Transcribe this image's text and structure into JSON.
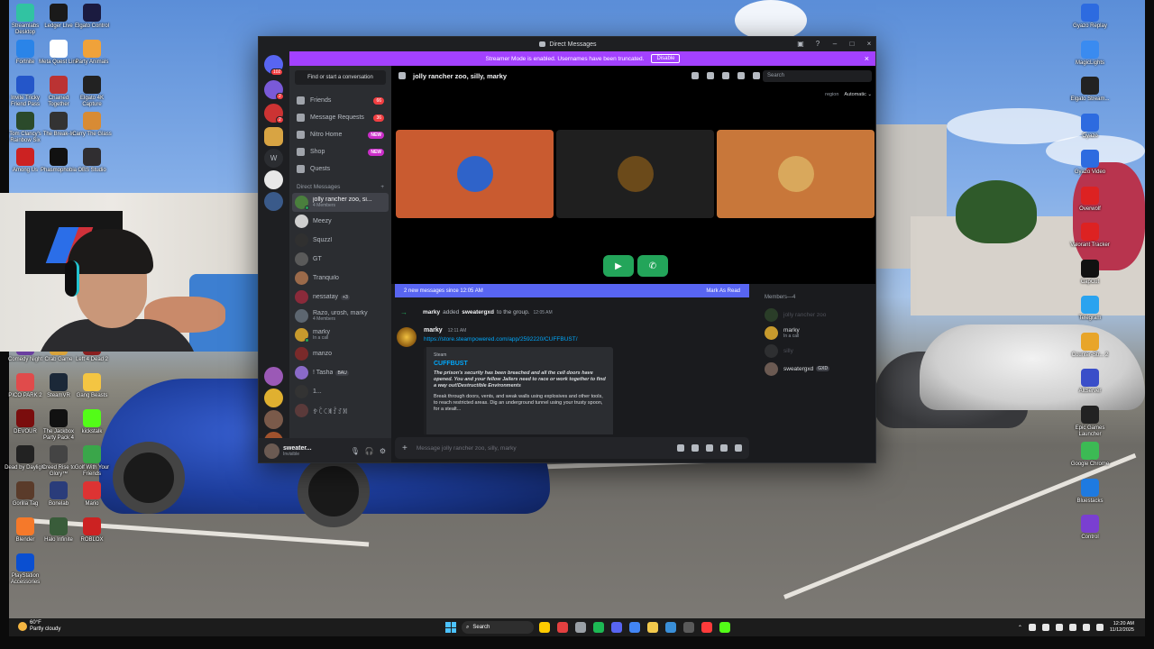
{
  "desktop": {
    "left_icons": [
      {
        "label": "Streamlabs Desktop",
        "color": "#31c3a2"
      },
      {
        "label": "Ledger Live",
        "color": "#1a1a1a"
      },
      {
        "label": "Elgato Control",
        "color": "#1b1b40"
      },
      {
        "label": "Fortnite",
        "color": "#2a84e8"
      },
      {
        "label": "Meta Quest Link",
        "color": "#ffffff"
      },
      {
        "label": "Party Animals",
        "color": "#f0a23a"
      },
      {
        "label": "Invite Tricky Friend Pass",
        "color": "#2456c9"
      },
      {
        "label": "Chained Together",
        "color": "#b33"
      },
      {
        "label": "Elgato 4K Capture",
        "color": "#222"
      },
      {
        "label": "Tom Clancy's Rainbow Six",
        "color": "#2b4a2b"
      },
      {
        "label": "The Break-In",
        "color": "#333"
      },
      {
        "label": "Carry The Glass",
        "color": "#d88b34"
      },
      {
        "label": "Among Us",
        "color": "#c22"
      },
      {
        "label": "Phasmophobia",
        "color": "#111"
      },
      {
        "label": "OBS Studio",
        "color": "#302e31"
      }
    ],
    "left_icons_lower": [
      {
        "label": "Comedy Night",
        "color": "#6b3fa0"
      },
      {
        "label": "Crab Game",
        "color": "#d9a33b"
      },
      {
        "label": "Left 4 Dead 2",
        "color": "#8a1f1f"
      },
      {
        "label": "PICO PARK 2",
        "color": "#e04b4b"
      },
      {
        "label": "SteamVR",
        "color": "#1b2838"
      },
      {
        "label": "Gang Beasts",
        "color": "#f4c542"
      },
      {
        "label": "DEVOUR",
        "color": "#7a0d0d"
      },
      {
        "label": "The Jackbox Party Pack 4",
        "color": "#111"
      },
      {
        "label": "kickstalk",
        "color": "#53fc18"
      },
      {
        "label": "Dead by Daylight",
        "color": "#222"
      },
      {
        "label": "Creed Rise to Glory™",
        "color": "#444"
      },
      {
        "label": "Golf With Your Friends",
        "color": "#3aa64a"
      },
      {
        "label": "Gorilla Tag",
        "color": "#5a3b2a"
      },
      {
        "label": "Bonelab",
        "color": "#2a3c7a"
      },
      {
        "label": "Mario",
        "color": "#d33"
      },
      {
        "label": "Blender",
        "color": "#f5792a"
      },
      {
        "label": "Halo Infinite",
        "color": "#395c3a"
      },
      {
        "label": "ROBLOX",
        "color": "#c22"
      },
      {
        "label": "PlayStation Accessories",
        "color": "#0a4fd1"
      }
    ],
    "right_icons": [
      {
        "label": "Gyazo Replay",
        "color": "#2d6be0"
      },
      {
        "label": "MagicLights",
        "color": "#3a8bf0"
      },
      {
        "label": "Elgato Stream...",
        "color": "#222"
      },
      {
        "label": "Gyazo",
        "color": "#2d6be0"
      },
      {
        "label": "Gyazo Video",
        "color": "#2d6be0"
      },
      {
        "label": "Overwolf",
        "color": "#d22"
      },
      {
        "label": "Valorant Tracker",
        "color": "#d22"
      },
      {
        "label": "CapCut",
        "color": "#111"
      },
      {
        "label": "Telegram",
        "color": "#2aa3ef"
      },
      {
        "label": "Counter-Str... 2",
        "color": "#e8a52a"
      },
      {
        "label": "AltServer",
        "color": "#3a4ec9"
      },
      {
        "label": "Epic Games Launcher",
        "color": "#222"
      },
      {
        "label": "Google Chrome",
        "color": "#3cba54"
      },
      {
        "label": "Bluestacks",
        "color": "#1e7ae0"
      },
      {
        "label": "Control",
        "color": "#7a3fd1"
      }
    ]
  },
  "discord": {
    "window_title": "Direct Messages",
    "streamer_banner": {
      "text": "Streamer Mode is enabled. Usernames have been truncated.",
      "button": "Disable"
    },
    "rail_badges": [
      "102",
      "2",
      "2"
    ],
    "search_placeholder": "Find or start a conversation",
    "nav": [
      {
        "label": "Friends",
        "pill": "66",
        "pill_type": "red",
        "icon": "friends-icon"
      },
      {
        "label": "Message Requests",
        "pill": "36",
        "pill_type": "red",
        "icon": "message-requests-icon"
      },
      {
        "label": "Nitro Home",
        "pill": "NEW",
        "pill_type": "new",
        "icon": "nitro-icon"
      },
      {
        "label": "Shop",
        "pill": "NEW",
        "pill_type": "new",
        "icon": "shop-icon"
      },
      {
        "label": "Quests",
        "pill": "",
        "pill_type": "",
        "icon": "quests-icon"
      }
    ],
    "dm_header": "Direct Messages",
    "dm_add": "+",
    "dms": [
      {
        "name": "jolly rancher zoo, si...",
        "sub": "4 Members",
        "color": "#4a7f3d",
        "active": true
      },
      {
        "name": "Meezy",
        "sub": "",
        "color": "#cfcfcf"
      },
      {
        "name": "Squzzl",
        "sub": "",
        "color": "#303030"
      },
      {
        "name": "GT",
        "sub": "",
        "color": "#5a5a5a"
      },
      {
        "name": "Tranquilo",
        "sub": "",
        "color": "#9b6a4a"
      },
      {
        "name": "nessatay",
        "sub": "",
        "color": "#8a2a3a",
        "tag": "+3"
      },
      {
        "name": "Razo, urosh, marky",
        "sub": "4 Members",
        "color": "#5d6670"
      },
      {
        "name": "marky",
        "sub": "In a call",
        "color": "#c79a2d"
      },
      {
        "name": "manzo",
        "sub": "",
        "color": "#7a2a2a"
      },
      {
        "name": "! Tasha",
        "sub": "",
        "color": "#8a6ac8",
        "tag": "BAU"
      },
      {
        "name": "1...",
        "sub": "",
        "color": "#333"
      },
      {
        "name": "ꉣꉓꉔꉛꉗꉘꉙ",
        "sub": "",
        "color": "#5a3a3a"
      }
    ],
    "user": {
      "name": "sweater...",
      "status": "Invisible"
    },
    "channel": {
      "name": "jolly rancher zoo, silly, marky",
      "search": "Search",
      "region_label": "region",
      "region_value": "Automatic ⌄"
    },
    "tiles": [
      {
        "bg": "#c95b30",
        "avatar": "#2f63c9"
      },
      {
        "bg": "#1f1f1f",
        "avatar": "#6b4a1a"
      },
      {
        "bg": "#c8773a",
        "avatar": "#d9a85c"
      }
    ],
    "new_messages": {
      "text": "2 new messages since 12:05 AM",
      "action": "Mark As Read"
    },
    "system_message": {
      "actor": "marky",
      "verb": "added",
      "target": "sweatergxd",
      "rest": "to the group.",
      "time": "12:05 AM"
    },
    "message": {
      "author": "marky",
      "time": "12:11 AM",
      "link": "https://store.steampowered.com/app/2592220/CUFFBUST/",
      "embed": {
        "provider": "Steam",
        "title": "CUFFBUST",
        "desc": "The prison's security has been breached and all the cell doors have opened. You and your fellow Jailers need to race or work together to find a way out!Destructible Environments",
        "desc2": "Break through doors, vents, and weak walls using explosives and other tools, to reach restricted areas. Dig an underground tunnel using your trusty spoon, for a stealt..."
      }
    },
    "composer_placeholder": "Message jolly rancher zoo, silly, marky",
    "members_header": "Members—4",
    "members": [
      {
        "name": "jolly rancher zoo",
        "sub": "",
        "color": "#4a7f3d",
        "dim": true
      },
      {
        "name": "marky",
        "sub": "In a call",
        "color": "#c79a2d",
        "dim": false
      },
      {
        "name": "silly",
        "sub": "",
        "color": "#555",
        "dim": true
      },
      {
        "name": "sweatergxd",
        "sub": "",
        "color": "#6b5a52",
        "dim": false,
        "tag": "GXD"
      }
    ]
  },
  "taskbar": {
    "weather_temp": "60°F",
    "weather_desc": "Partly cloudy",
    "search": "Search",
    "time": "12:20 AM",
    "date": "11/12/2025",
    "apps": [
      "#ffcc00",
      "#e34040",
      "#9aa0a6",
      "#1db954",
      "#5865f2",
      "#4285f4",
      "#f2c94c",
      "#3a8fd8",
      "#5a5a5a",
      "#ff3b3b",
      "#53fc18"
    ]
  }
}
